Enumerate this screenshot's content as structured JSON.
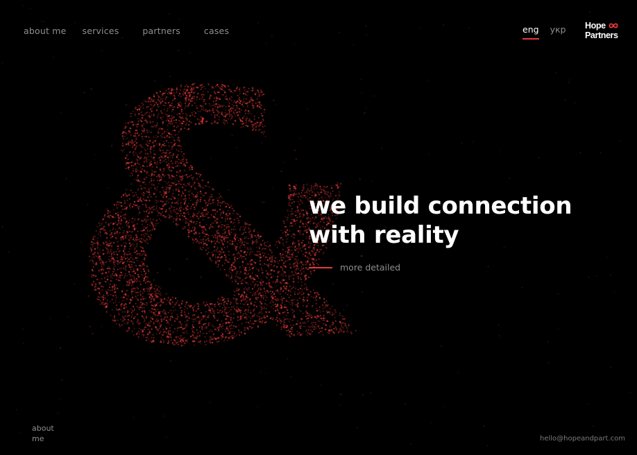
{
  "nav": {
    "items": [
      {
        "label": "about me"
      },
      {
        "label": "services"
      },
      {
        "label": "partners"
      },
      {
        "label": "cases"
      }
    ]
  },
  "lang": {
    "options": [
      "eng",
      "укр"
    ],
    "active": "eng"
  },
  "logo": {
    "line1": "Hope",
    "line2": "Partners",
    "icon": "infinity-icon"
  },
  "hero": {
    "line1": "we build connection",
    "line2": "with reality",
    "more_label": "more detailed",
    "symbol": "&"
  },
  "footer": {
    "section_label": "about me",
    "email": "hello@hopeandpart.com"
  },
  "colors": {
    "background": "#000000",
    "accent": "#e63a3a",
    "muted": "#8f8f8f",
    "text": "#ffffff"
  }
}
